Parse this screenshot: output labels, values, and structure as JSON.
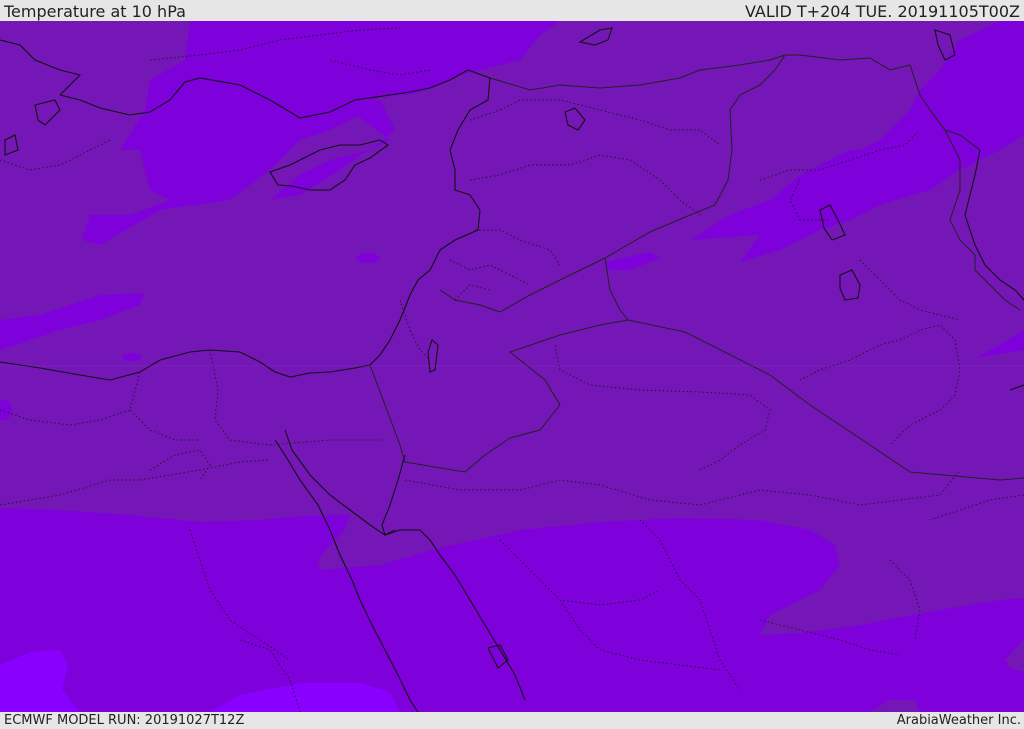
{
  "header": {
    "title": "Temperature at 10 hPa",
    "valid": "VALID T+204 TUE. 20191105T00Z"
  },
  "footer": {
    "model_run": "ECMWF MODEL RUN: 20191027T12Z",
    "credit": "ArabiaWeather Inc."
  },
  "colors": {
    "band_dark": "#7417b6",
    "band_mid": "#7e00db",
    "band_light": "#8a00ff",
    "coastline": "#111111",
    "border": "#222222"
  }
}
